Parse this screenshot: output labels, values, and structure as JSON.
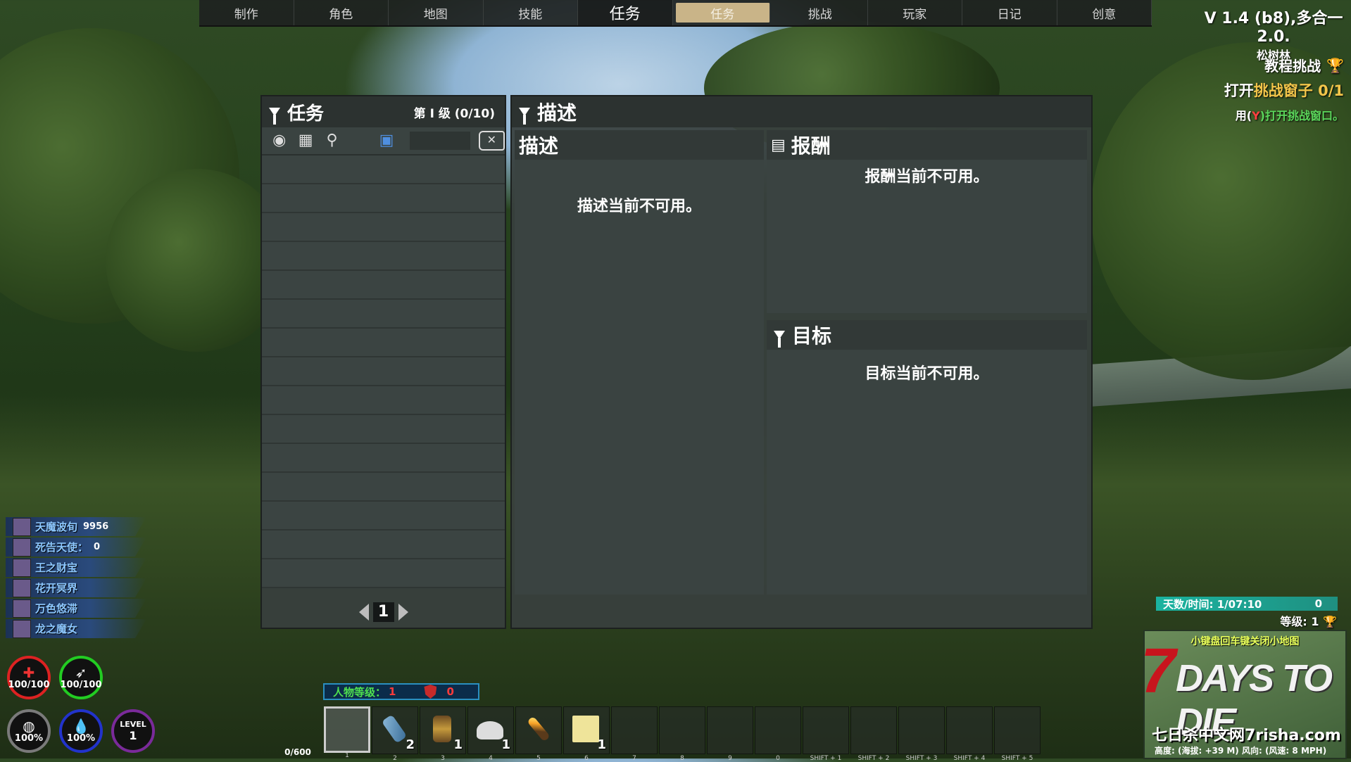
{
  "top_tabs": [
    {
      "label": "制作"
    },
    {
      "label": "角色"
    },
    {
      "label": "地图"
    },
    {
      "label": "技能"
    },
    {
      "label": "任务"
    },
    {
      "label": "任务"
    },
    {
      "label": "挑战"
    },
    {
      "label": "玩家"
    },
    {
      "label": "日记"
    },
    {
      "label": "创意"
    }
  ],
  "version": {
    "text": "V 1.4 (b8),多合一2.0.",
    "biome": "松树林"
  },
  "challenge": {
    "title": "教程挑战",
    "task_prefix": "打开",
    "task_highlight": "挑战窗子",
    "task_progress": "0/1",
    "hint_prefix": "用(",
    "hint_key": "Y",
    "hint_suffix": ")打开挑战窗口。"
  },
  "quest_panel": {
    "title": "任务",
    "tier": "第 I 级  (0/10)",
    "page": "1"
  },
  "description_panel": {
    "title": "描述",
    "sub_title": "描述",
    "message": "描述当前不可用。"
  },
  "reward_panel": {
    "title": "报酬",
    "message": "报酬当前不可用。"
  },
  "objective_panel": {
    "title": "目标",
    "message": "目标当前不可用。"
  },
  "players": [
    {
      "name": "天魔波旬",
      "score": "9956"
    },
    {
      "name": "死告天使：",
      "score": "0"
    },
    {
      "name": "王之财宝",
      "score": ""
    },
    {
      "name": "花开冥界",
      "score": ""
    },
    {
      "name": "万色悠滞",
      "score": ""
    },
    {
      "name": "龙之魔女",
      "score": ""
    }
  ],
  "stats": {
    "health": "100/100",
    "stamina": "100/100",
    "food": "100%",
    "water": "100%",
    "level_label": "LEVEL",
    "level_value": "1"
  },
  "xp_bar": {
    "label": "人物等级：",
    "level": "1",
    "threat": "0"
  },
  "bag": {
    "capacity": "0/600"
  },
  "toolbelt": [
    {
      "count": "",
      "key": "1"
    },
    {
      "count": "2",
      "key": "2"
    },
    {
      "count": "1",
      "key": "3"
    },
    {
      "count": "1",
      "key": "4"
    },
    {
      "count": "",
      "key": "5"
    },
    {
      "count": "1",
      "key": "6"
    },
    {
      "count": "",
      "key": "7"
    },
    {
      "count": "",
      "key": "8"
    },
    {
      "count": "",
      "key": "9"
    },
    {
      "count": "",
      "key": "0"
    },
    {
      "count": "",
      "key": "SHIFT + 1"
    },
    {
      "count": "",
      "key": "SHIFT + 2"
    },
    {
      "count": "",
      "key": "SHIFT + 3"
    },
    {
      "count": "",
      "key": "SHIFT + 4"
    },
    {
      "count": "",
      "key": "SHIFT + 5"
    }
  ],
  "day_time": {
    "text": "天数/时间: 1/07:10",
    "coins": "0"
  },
  "level_line": "等级: 1",
  "minimap": {
    "hint": "小键盘回车键关闭小地图",
    "logo_seven": "7",
    "logo": "DAYS TO DIE",
    "watermark": "七日杀中文网7risha.com",
    "height_line": "高度: (海拔: +39 M)  风向: (风速: 8 MPH)"
  },
  "colors": {
    "active_tab": "#c9b488",
    "panel": "#38403d",
    "highlight": "#f2c54a",
    "xp_text": "#4fe04f"
  }
}
